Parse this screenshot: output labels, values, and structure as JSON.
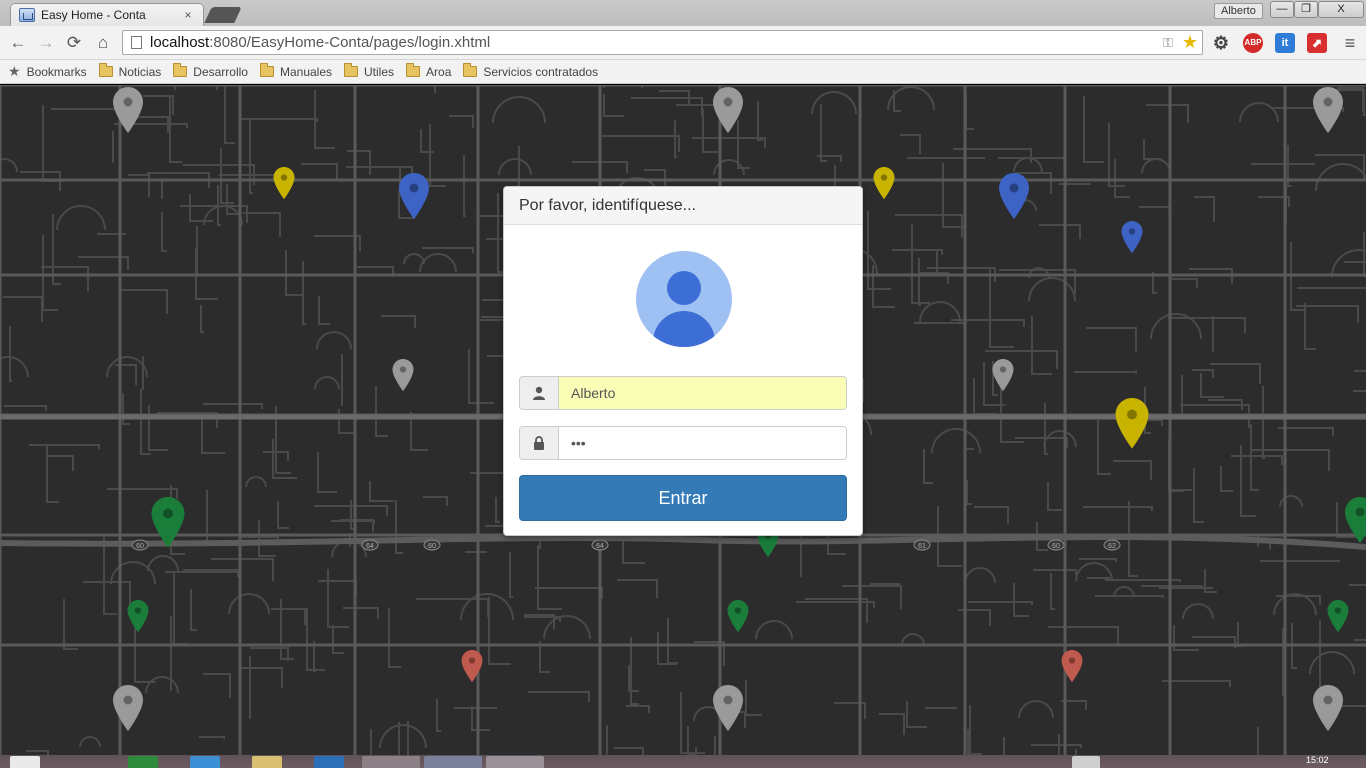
{
  "browser": {
    "tab_title": "Easy Home - Conta",
    "tab_close": "×",
    "user_name": "Alberto",
    "window_controls": {
      "minimize": "—",
      "maximize": "❐",
      "close": "X"
    },
    "nav": {
      "back_icon": "←",
      "forward_icon": "→",
      "reload_icon": "⟳",
      "home_icon": "⌂"
    },
    "url": {
      "host": "localhost",
      "rest": ":8080/EasyHome-Conta/pages/login.xhtml"
    },
    "extensions": {
      "settings_icon": "⚙",
      "abp_label": "ABP",
      "it_label": "it",
      "red_label": "⬈",
      "menu_icon": "≡"
    },
    "bookmarks_label": "Bookmarks",
    "bookmark_folders": [
      "Noticias",
      "Desarrollo",
      "Manuales",
      "Utiles",
      "Aroa",
      "Servicios contratados"
    ]
  },
  "login": {
    "heading": "Por favor, identifíquese...",
    "username_value": "Alberto",
    "password_value": "•••",
    "submit_label": "Entrar"
  },
  "map": {
    "road_labels": [
      "60",
      "64",
      "60",
      "64",
      "61",
      "60",
      "62"
    ],
    "pin_colors": {
      "gray": "#9a9a9a",
      "yellow": "#c8b400",
      "blue": "#3d63c4",
      "green": "#1b7d3a",
      "red": "#c05a4e"
    }
  },
  "taskbar": {
    "clock": "15:02"
  }
}
